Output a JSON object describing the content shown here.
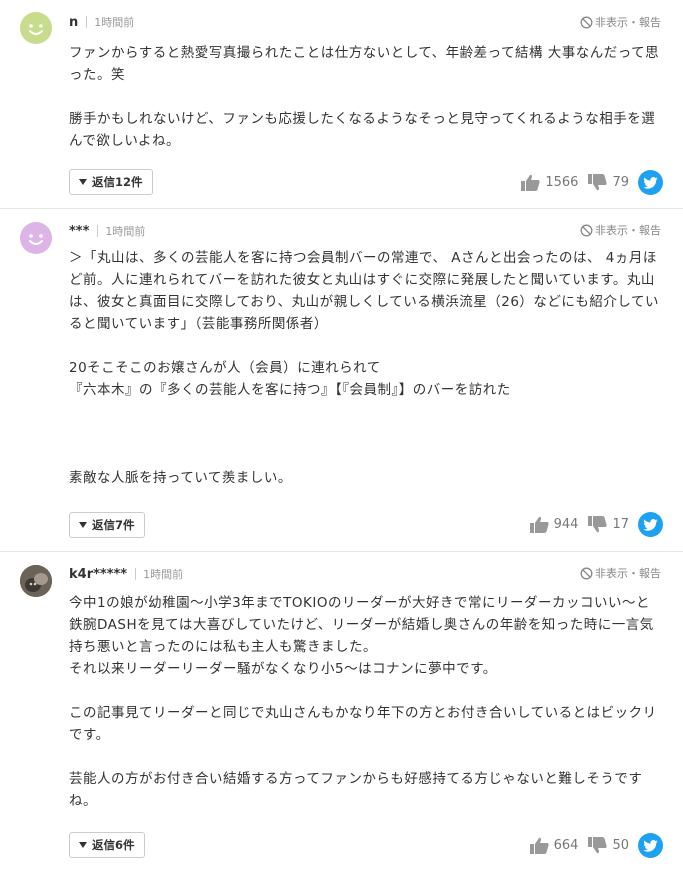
{
  "comments": [
    {
      "user": "n",
      "time": "1時間前",
      "hide_report": "非表示・報告",
      "avatar_color": "#c7dc8c",
      "body": "ファンからすると熱愛写真撮られたことは仕方ないとして、年齢差って結構 大事なんだって思った。笑\n\n勝手かもしれないけど、ファンも応援したくなるようなそっと見守ってくれるような相手を選んで欲しいよね。",
      "reply": "返信12件",
      "likes": "1566",
      "dislikes": "79"
    },
    {
      "user": "***",
      "time": "1時間前",
      "hide_report": "非表示・報告",
      "avatar_color": "#dcb4e6",
      "body": "＞「丸山は、多くの芸能人を客に持つ会員制バーの常連で、 Aさんと出会ったのは、 4ヵ月ほど前。人に連れられてバーを訪れた彼女と丸山はすぐに交際に発展したと聞いています。丸山は、彼女と真面目に交際しており、丸山が親しくしている横浜流星（26）などにも紹介していると聞いています」（芸能事務所関係者）\n\n20そこそこのお嬢さんが人（会員）に連れられて\n『六本木』の『多くの芸能人を客に持つ』【『会員制』】のバーを訪れた\n\n\n\n素敵な人脈を持っていて羨ましい。",
      "reply": "返信7件",
      "likes": "944",
      "dislikes": "17"
    },
    {
      "user": "k4r*****",
      "time": "1時間前",
      "hide_report": "非表示・報告",
      "avatar_color": "#6b6258",
      "body": "今中1の娘が幼稚園〜小学3年までTOKIOのリーダーが大好きで常にリーダーカッコいい〜と鉄腕DASHを見ては大喜びしていたけど、リーダーが結婚し奥さんの年齢を知った時に一言気持ち悪いと言ったのには私も主人も驚きました。\nそれ以来リーダーリーダー騒がなくなり小5〜はコナンに夢中です。\n\nこの記事見てリーダーと同じで丸山さんもかなり年下の方とお付き合いしているとはビックリです。\n\n芸能人の方がお付き合い結婚する方ってファンからも好感持てる方じゃないと難しそうですね。",
      "reply": "返信6件",
      "likes": "664",
      "dislikes": "50"
    }
  ],
  "icons": {
    "hide": "prohibited-icon",
    "like": "thumbs-up-icon",
    "dislike": "thumbs-down-icon",
    "share": "twitter-icon",
    "expand": "triangle-down-icon"
  },
  "colors": {
    "twitter": "#1da1f2",
    "muted": "#999999"
  }
}
